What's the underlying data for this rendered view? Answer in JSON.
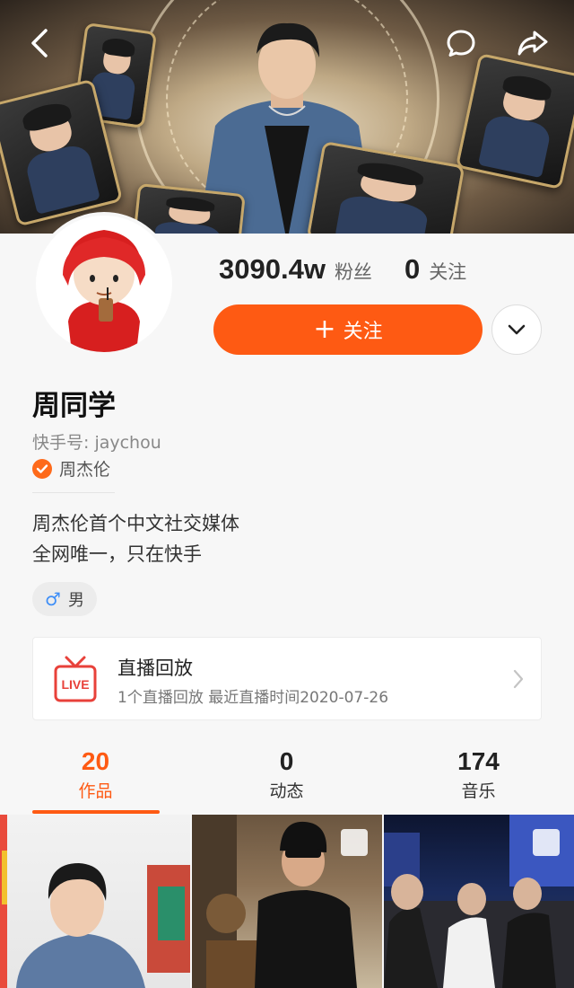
{
  "profile": {
    "name": "周同学",
    "kuaishou_id": "快手号: jaychou",
    "verified_name": "周杰伦",
    "bio_line1": "周杰伦首个中文社交媒体",
    "bio_line2": "全网唯一，只在快手",
    "gender": "男"
  },
  "stats": {
    "fans_count": "3090.4w",
    "fans_label": "粉丝",
    "following_count": "0",
    "following_label": "关注"
  },
  "actions": {
    "follow_label": "关注"
  },
  "live_replay": {
    "icon_text": "LIVE",
    "title": "直播回放",
    "subtitle": "1个直播回放 最近直播时间2020-07-26"
  },
  "tabs": [
    {
      "count": "20",
      "label": "作品",
      "active": true
    },
    {
      "count": "0",
      "label": "动态",
      "active": false
    },
    {
      "count": "174",
      "label": "音乐",
      "active": false
    }
  ],
  "icons": {
    "back": "back-arrow-icon",
    "comment": "comment-icon",
    "share": "share-icon",
    "more": "chevron-down-icon"
  },
  "colors": {
    "accent": "#fe5a13",
    "verified": "#fe6a1a",
    "gender": "#3e8ef7"
  }
}
